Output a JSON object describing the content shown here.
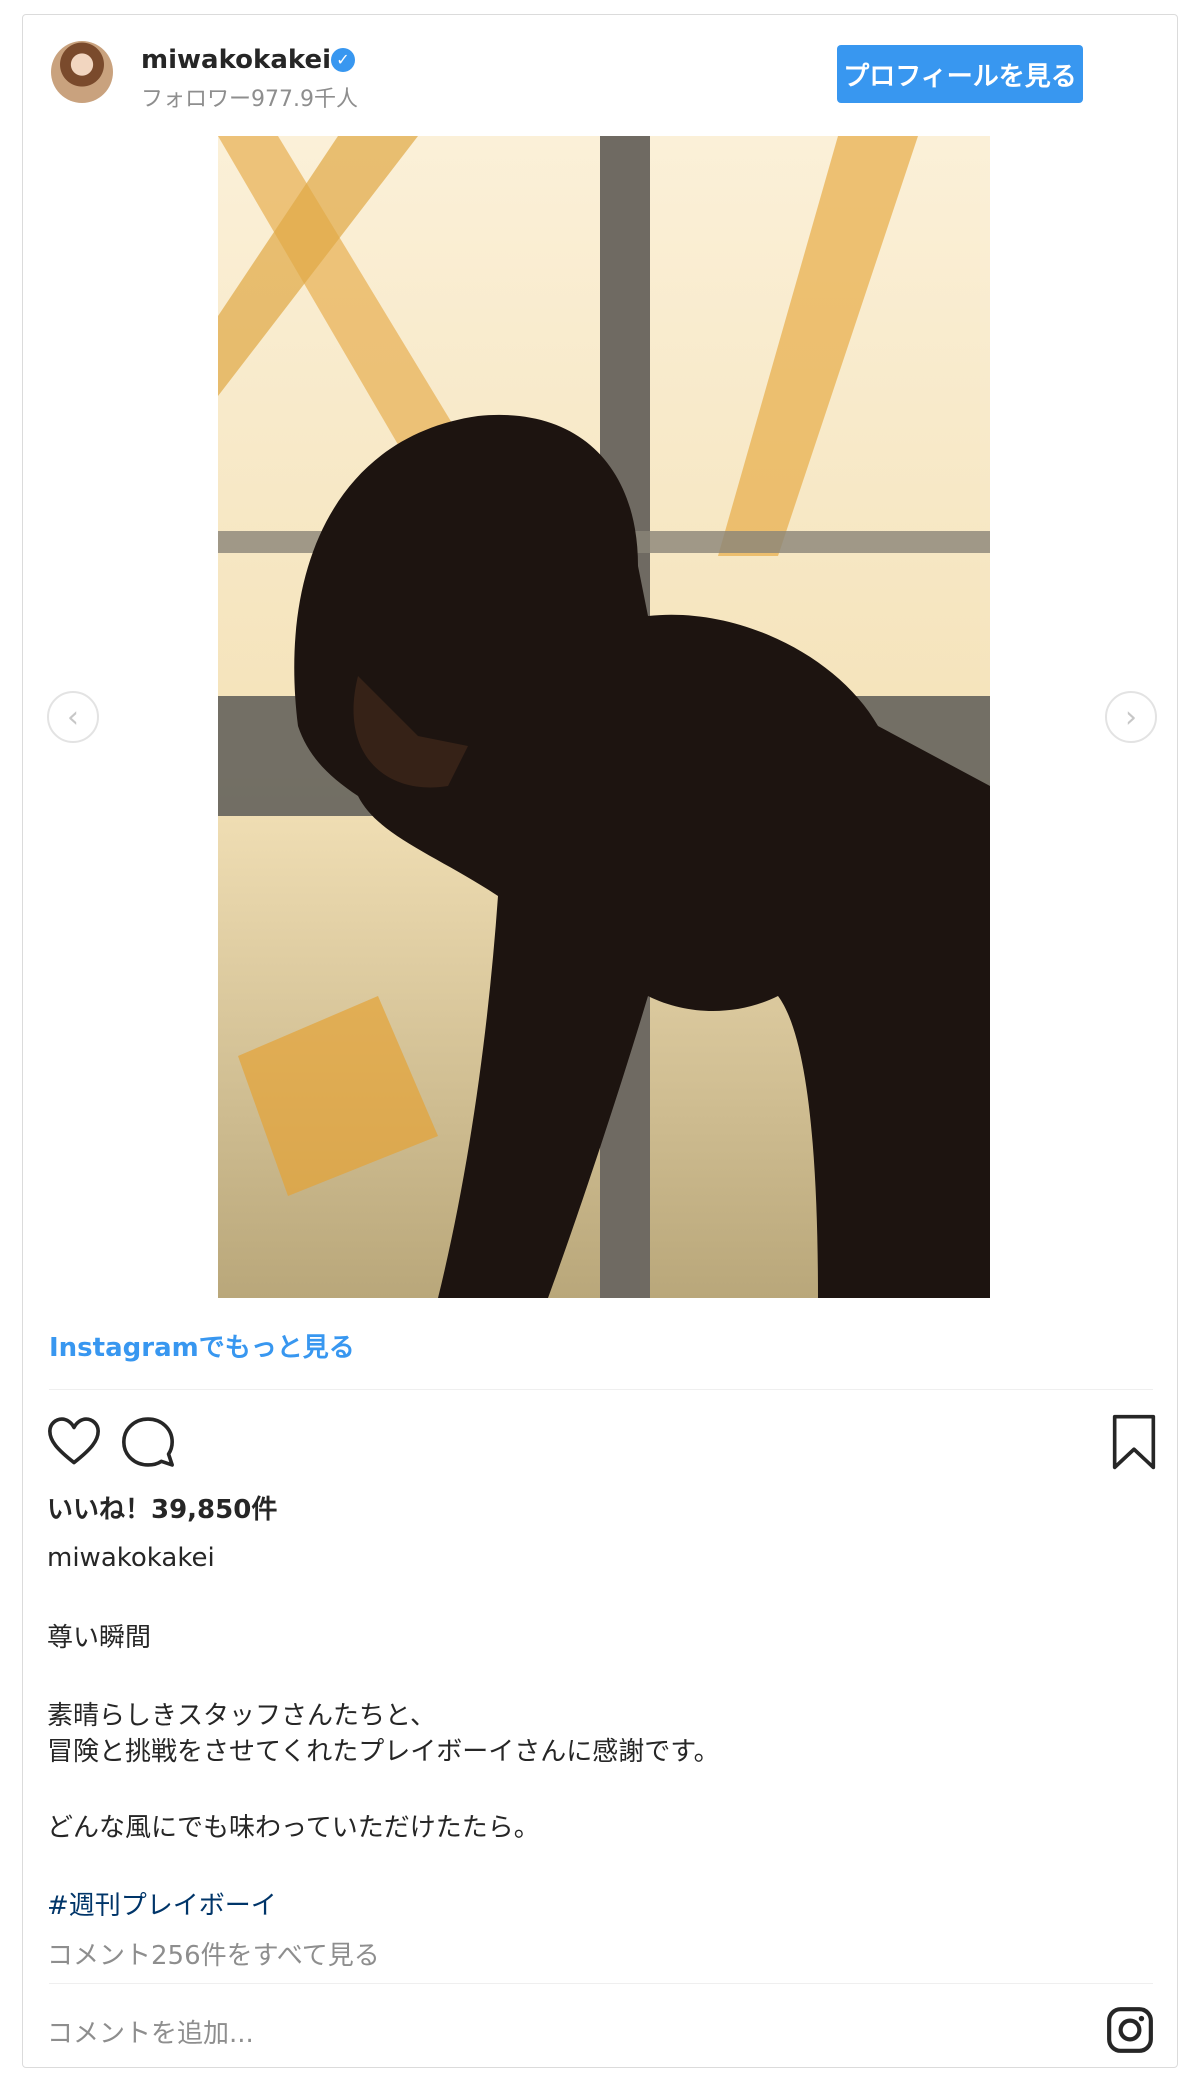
{
  "header": {
    "username": "miwakokakei",
    "verified_glyph": "✓",
    "followers": "フォロワー977.9千人",
    "profile_button": "プロフィールを見る"
  },
  "media": {
    "carousel_prev": "‹",
    "carousel_next": "›"
  },
  "more_link": "Instagramでもっと見る",
  "actions": {
    "like_icon": "heart-icon",
    "comment_icon": "comment-icon",
    "save_icon": "bookmark-icon"
  },
  "likes": "いいね！39,850件",
  "caption": {
    "username": "miwakokakei",
    "lines": [
      "尊い瞬間",
      "素晴らしきスタッフさんたちと、",
      "冒険と挑戦をさせてくれたプレイボーイさんに感謝です。",
      "どんな風にでも味わっていただけたたら。"
    ],
    "hashtag": "#週刊プレイボーイ"
  },
  "view_comments": "コメント256件をすべて見る",
  "add_comment_placeholder": "コメントを追加...",
  "colors": {
    "accent": "#3897f0",
    "hashtag": "#003569",
    "muted": "#8e8e8e",
    "text": "#262626"
  }
}
